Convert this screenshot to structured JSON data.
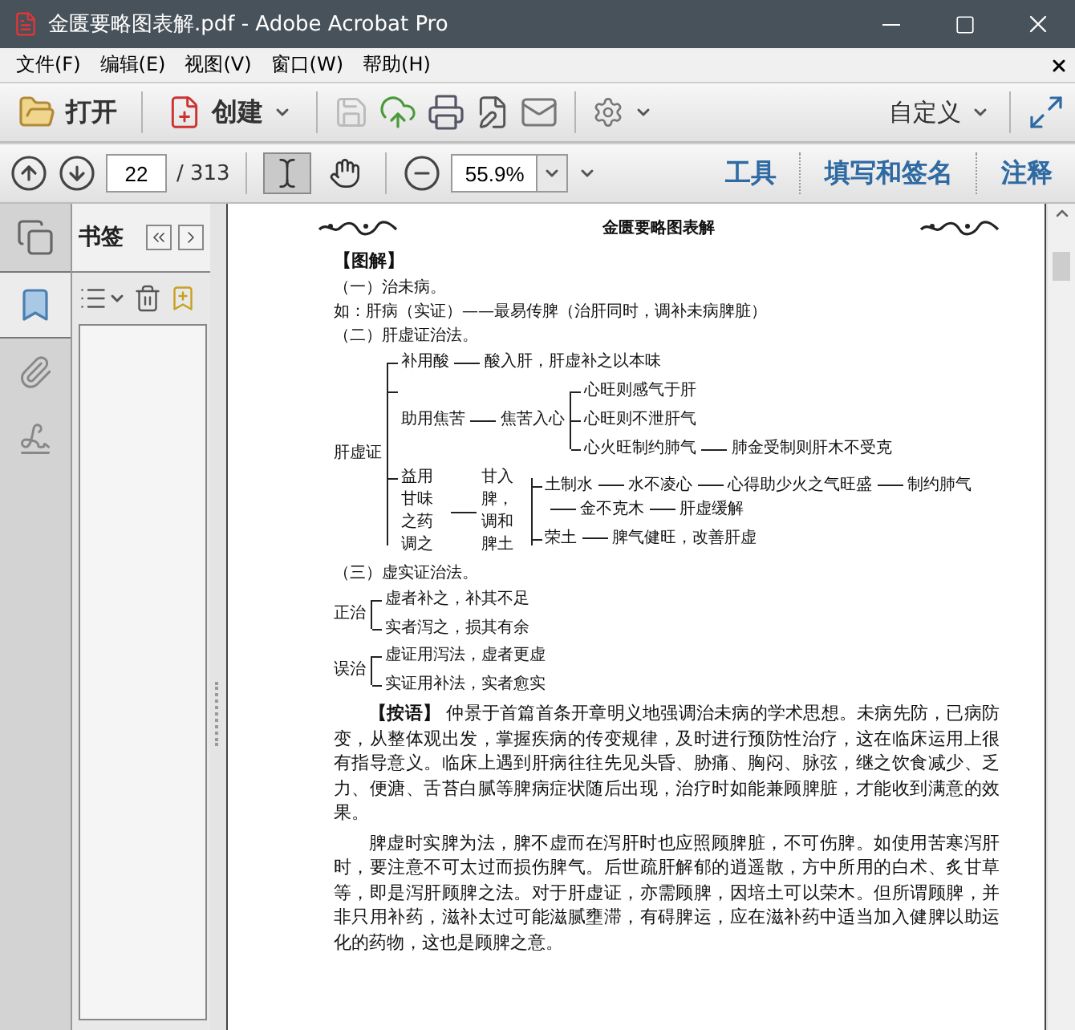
{
  "window": {
    "title": "金匮要略图表解.pdf - Adobe Acrobat Pro"
  },
  "menu": [
    "文件(F)",
    "编辑(E)",
    "视图(V)",
    "窗口(W)",
    "帮助(H)"
  ],
  "toolbar": {
    "open": "打开",
    "create": "创建",
    "customize": "自定义"
  },
  "nav": {
    "page": "22",
    "total": "/ 313",
    "zoom": "55.9%",
    "tools": [
      {
        "kind": "select",
        "selected": true
      },
      {
        "kind": "hand",
        "selected": false
      }
    ],
    "tabs": [
      "工具",
      "填写和签名",
      "注释"
    ]
  },
  "sidebar": {
    "tabs": [
      {
        "kind": "pages",
        "selected": false
      },
      {
        "kind": "bookmarks",
        "selected": true
      },
      {
        "kind": "attachments",
        "selected": false
      },
      {
        "kind": "signatures",
        "selected": false
      }
    ],
    "panel_title": "书签"
  },
  "document": {
    "running_head": "金匮要略图表解",
    "section": "【图解】",
    "blocks": [
      {
        "kind": "line",
        "text": "（一）治未病。"
      },
      {
        "kind": "line",
        "text": "如：肝病（实证）——最易传脾（治肝同时，调补未病脾脏）"
      },
      {
        "kind": "line",
        "text": "（二）肝虚证治法。"
      },
      {
        "kind": "tree",
        "root": {
          "chain": [
            "肝虚证"
          ],
          "children": [
            {
              "chain": [
                "补用酸",
                "酸入肝，肝虚补之以本味"
              ]
            },
            {
              "chain": [
                "助用焦苦",
                "焦苦入心"
              ],
              "children": [
                {
                  "chain": [
                    "心旺则感气于肝"
                  ]
                },
                {
                  "chain": [
                    "心旺则不泄肝气"
                  ]
                },
                {
                  "chain": [
                    "心火旺制约肺气",
                    "肺金受制则肝木不受克"
                  ]
                }
              ]
            },
            {
              "chain": [
                "益用甘味之药调之",
                "甘入脾，调和脾土"
              ],
              "children": [
                {
                  "chain": [
                    "土制水",
                    "水不凌心",
                    "心得助少火之气旺盛",
                    "制约肺气",
                    "金不克木",
                    "肝虚缓解"
                  ]
                },
                {
                  "chain": [
                    "荣土",
                    "脾气健旺，改善肝虚"
                  ]
                }
              ]
            }
          ]
        }
      },
      {
        "kind": "line",
        "text": "（三）虚实证治法。"
      },
      {
        "kind": "tree",
        "root": {
          "chain": [
            "正治"
          ],
          "children": [
            {
              "chain": [
                "虚者补之，补其不足"
              ]
            },
            {
              "chain": [
                "实者泻之，损其有余"
              ]
            }
          ]
        }
      },
      {
        "kind": "tree",
        "root": {
          "chain": [
            "误治"
          ],
          "children": [
            {
              "chain": [
                "虚证用泻法，虚者更虚"
              ]
            },
            {
              "chain": [
                "实证用补法，实者愈实"
              ]
            }
          ]
        }
      },
      {
        "kind": "paragraph",
        "text": "**【按语】** 仲景于首篇首条开章明义地强调治未病的学术思想。未病先防，已病防变，从整体观出发，掌握疾病的传变规律，及时进行预防性治疗，这在临床运用上很有指导意义。临床上遇到肝病往往先见头昏、胁痛、胸闷、脉弦，继之饮食减少、乏力、便溏、舌苔白腻等脾病症状随后出现，治疗时如能兼顾脾脏，才能收到满意的效果。"
      },
      {
        "kind": "paragraph",
        "text": "脾虚时实脾为法，脾不虚而在泻肝时也应照顾脾脏，不可伤脾。如使用苦寒泻肝时，要注意不可太过而损伤脾气。后世疏肝解郁的逍遥散，方中所用的白术、炙甘草等，即是泻肝顾脾之法。对于肝虚证，亦需顾脾，因培土可以荣木。但所谓顾脾，并非只用补药，滋补太过可能滋腻壅滞，有碍脾运，应在滋补药中适当加入健脾以助运化的药物，这也是顾脾之意。"
      }
    ]
  }
}
